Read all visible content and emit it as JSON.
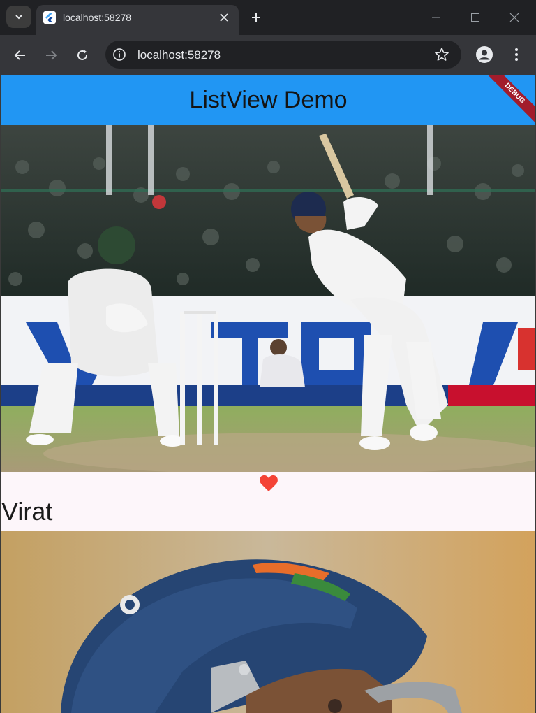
{
  "browser": {
    "tab_title": "localhost:58278",
    "url": "localhost:58278",
    "icons": {
      "tab_search": "chevron-down-icon",
      "favicon": "flutter-icon",
      "tab_close": "close-icon",
      "new_tab": "plus-icon",
      "back": "arrow-left-icon",
      "forward": "arrow-right-icon",
      "reload": "reload-icon",
      "site_info": "info-icon",
      "bookmark": "star-icon",
      "profile": "profile-icon",
      "menu": "kebab-menu-icon",
      "minimize": "minimize-icon",
      "maximize": "maximize-icon",
      "close_window": "window-close-icon"
    }
  },
  "app": {
    "title": "ListView Demo",
    "debug_banner": "DEBUG",
    "colors": {
      "appbar": "#2196f3",
      "background": "#fdf6fa",
      "heart": "#f44336",
      "debug_banner": "#a21c2c"
    },
    "list": {
      "items": [
        {
          "image": "batsman-playing-shot-photo",
          "liked": true,
          "name": "Virat"
        },
        {
          "image": "batsman-helmet-closeup-photo"
        }
      ]
    }
  }
}
